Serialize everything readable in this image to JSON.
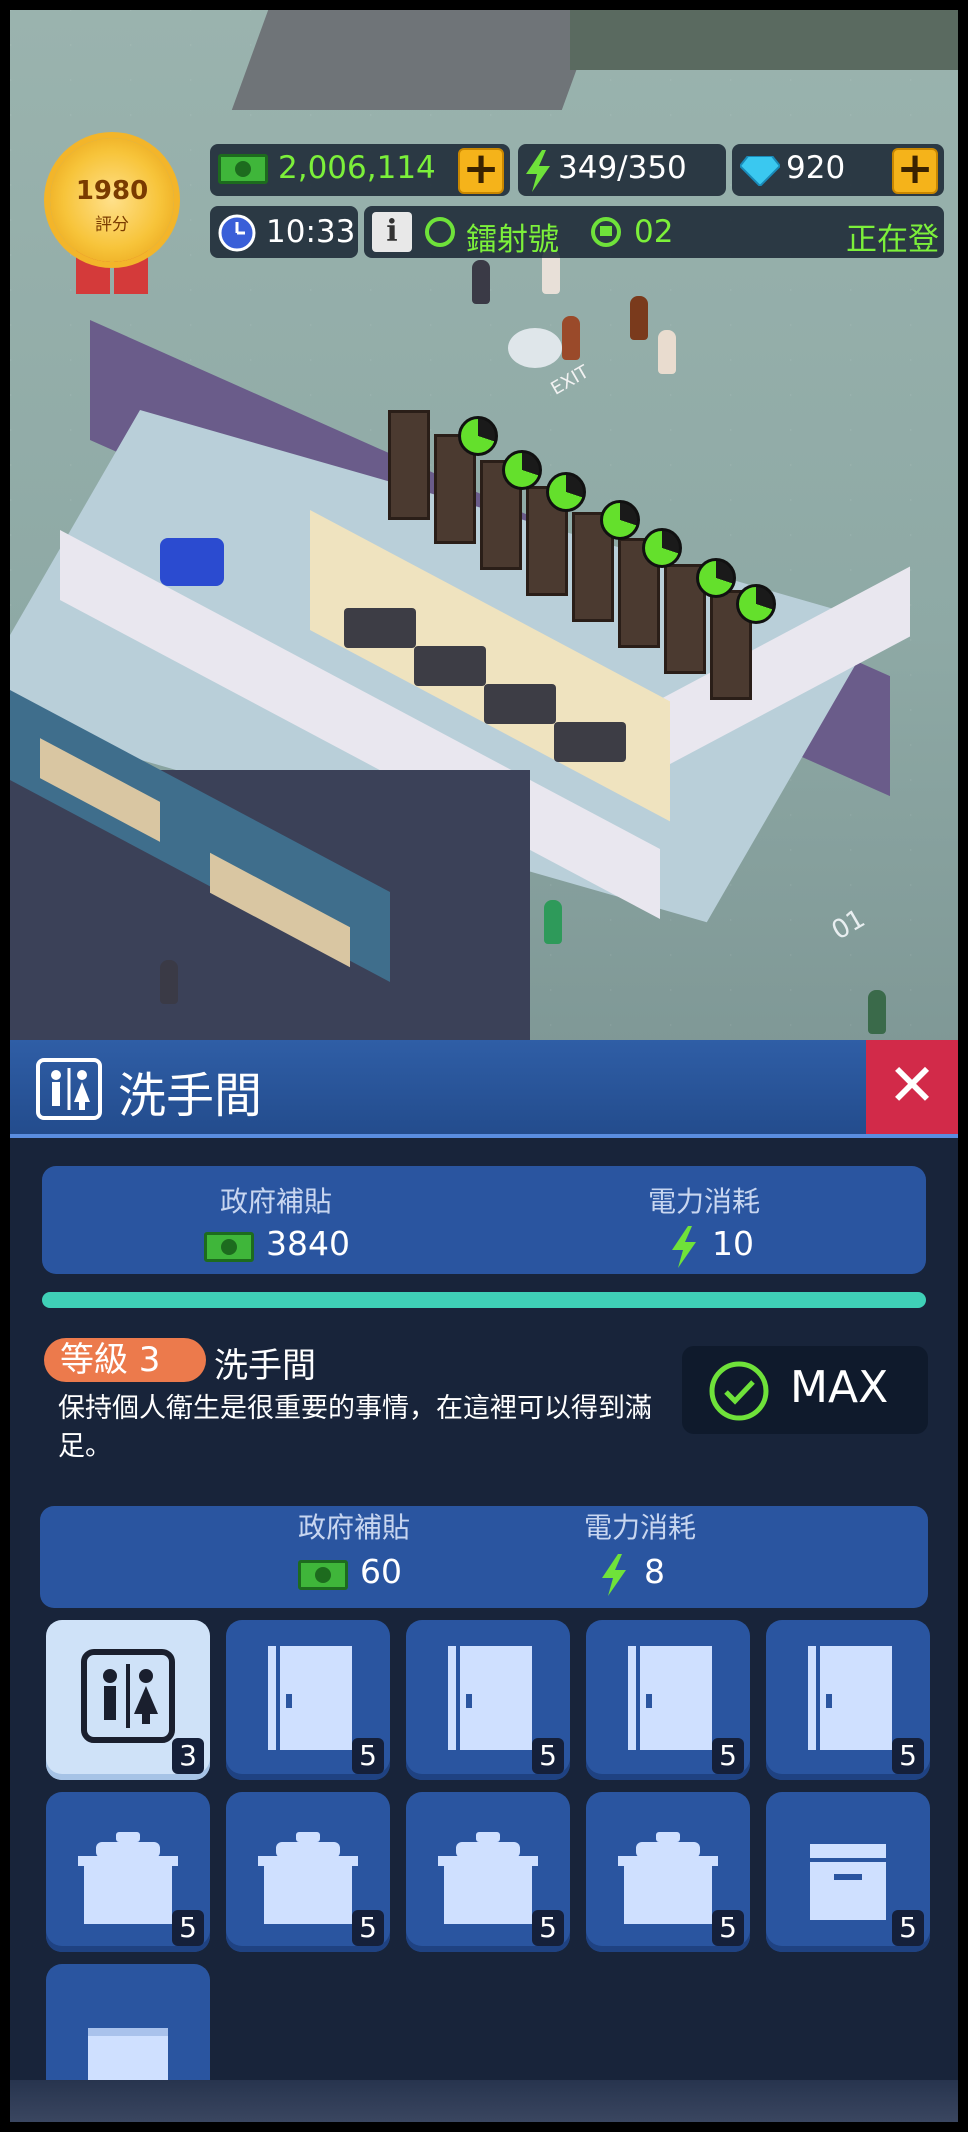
{
  "hud": {
    "cash": "2,006,114",
    "energy": "349/350",
    "gems": "920",
    "time": "10:33",
    "line_name": "鐳射號",
    "line_number": "02",
    "status": "正在登"
  },
  "badge": {
    "rating": "1980",
    "label": "評分"
  },
  "scene": {
    "exit_sign": "EXIT",
    "platform_number": "01"
  },
  "panel": {
    "title": "洗手間",
    "close_label": "✕",
    "totals": {
      "subsidy_label": "政府補貼",
      "subsidy_value": "3840",
      "power_label": "電力消耗",
      "power_value": "10"
    },
    "level_label": "等級 3",
    "facility_name": "洗手間",
    "description": "保持個人衛生是很重要的事情，在這裡可以得到滿足。",
    "max_label": "MAX",
    "item_stats": {
      "subsidy_label": "政府補貼",
      "subsidy_value": "60",
      "power_label": "電力消耗",
      "power_value": "8"
    },
    "tiles": [
      {
        "icon": "restroom-sign-icon",
        "count": "3"
      },
      {
        "icon": "toilet-stall-icon",
        "count": "5"
      },
      {
        "icon": "toilet-stall-icon",
        "count": "5"
      },
      {
        "icon": "toilet-stall-icon",
        "count": "5"
      },
      {
        "icon": "toilet-stall-icon",
        "count": "5"
      },
      {
        "icon": "washbasin-icon",
        "count": "5"
      },
      {
        "icon": "washbasin-icon",
        "count": "5"
      },
      {
        "icon": "washbasin-icon",
        "count": "5"
      },
      {
        "icon": "washbasin-icon",
        "count": "5"
      },
      {
        "icon": "hand-dryer-icon",
        "count": "5"
      },
      {
        "icon": "cabinet-icon",
        "count": ""
      }
    ]
  },
  "colors": {
    "panel_bg": "#18243a",
    "header_blue": "#2f5ea6",
    "stat_box": "#2a55a0",
    "teal_bar": "#3fd0b7",
    "level_pill": "#ec7a4c",
    "close_red": "#d22a49",
    "hud_green": "#7cf03a"
  }
}
